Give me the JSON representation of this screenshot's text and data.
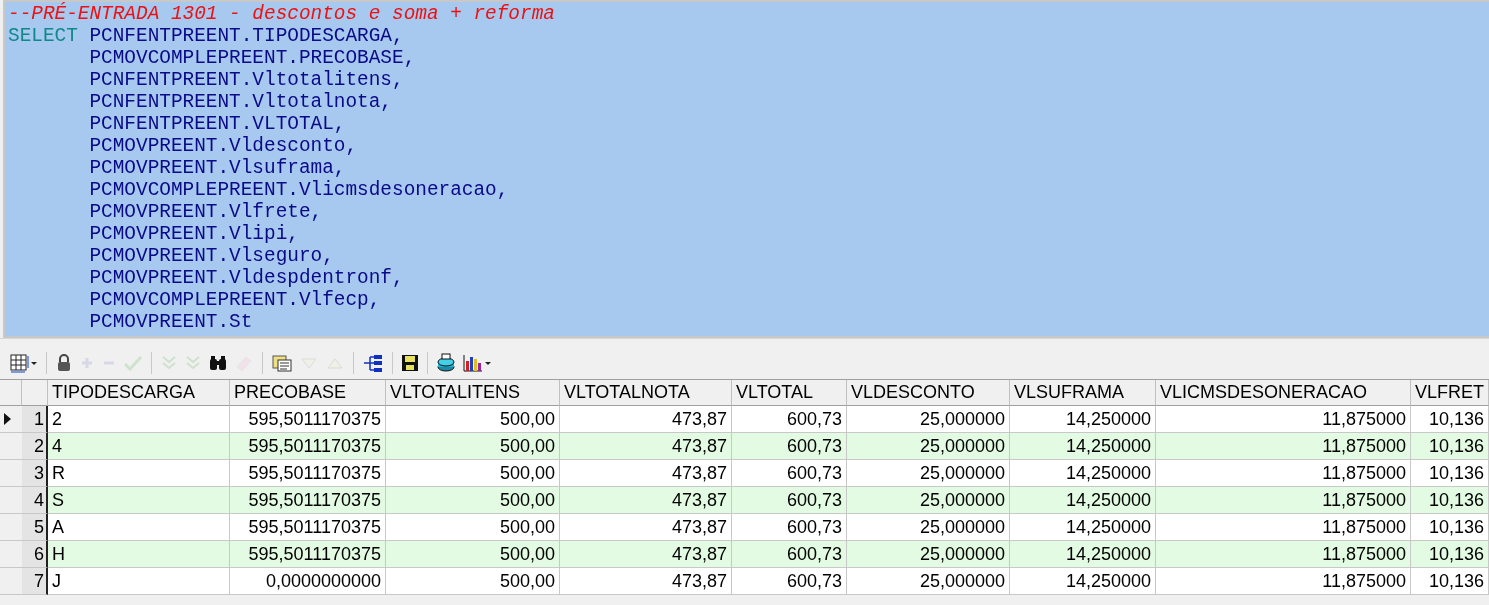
{
  "editor": {
    "lines": [
      {
        "kind": "comment",
        "code": "--PRÉ-ENTRADA 1301 - descontos e soma + reforma"
      },
      {
        "kind": "code",
        "keyword": "SELECT",
        "code": "PCNFENTPREENT.TIPODESCARGA,"
      },
      {
        "kind": "code",
        "code": "PCMOVCOMPLEPREENT.PRECOBASE,"
      },
      {
        "kind": "code",
        "code": "PCNFENTPREENT.Vltotalitens,"
      },
      {
        "kind": "code",
        "code": "PCNFENTPREENT.Vltotalnota,"
      },
      {
        "kind": "code",
        "code": "PCNFENTPREENT.VLTOTAL,"
      },
      {
        "kind": "code",
        "code": "PCMOVPREENT.Vldesconto,"
      },
      {
        "kind": "code",
        "code": "PCMOVPREENT.Vlsuframa,"
      },
      {
        "kind": "code",
        "code": "PCMOVCOMPLEPREENT.Vlicmsdesoneracao,"
      },
      {
        "kind": "code",
        "code": "PCMOVPREENT.Vlfrete,"
      },
      {
        "kind": "code",
        "code": "PCMOVPREENT.Vlipi,"
      },
      {
        "kind": "code",
        "code": "PCMOVPREENT.Vlseguro,"
      },
      {
        "kind": "code",
        "code": "PCMOVPREENT.Vldespdentronf,"
      },
      {
        "kind": "code",
        "code": "PCMOVCOMPLEPREENT.Vlfecp,"
      },
      {
        "kind": "code",
        "code": "PCMOVPREENT.St"
      }
    ]
  },
  "toolbar": [
    {
      "kind": "grid",
      "disabled": false
    },
    {
      "kind": "separator"
    },
    {
      "kind": "lock",
      "disabled": false
    },
    {
      "kind": "plus",
      "disabled": true
    },
    {
      "kind": "minus",
      "disabled": true
    },
    {
      "kind": "check",
      "disabled": true
    },
    {
      "kind": "separator"
    },
    {
      "kind": "chevrons",
      "disabled": true
    },
    {
      "kind": "chevrons",
      "disabled": true
    },
    {
      "kind": "binoculars",
      "disabled": false
    },
    {
      "kind": "eraser",
      "disabled": true
    },
    {
      "kind": "separator"
    },
    {
      "kind": "notes",
      "disabled": false
    },
    {
      "kind": "down",
      "disabled": true
    },
    {
      "kind": "up",
      "disabled": true
    },
    {
      "kind": "separator"
    },
    {
      "kind": "tree",
      "disabled": false
    },
    {
      "kind": "separator"
    },
    {
      "kind": "save",
      "disabled": false
    },
    {
      "kind": "separator"
    },
    {
      "kind": "database",
      "disabled": false
    },
    {
      "kind": "chart",
      "disabled": false
    }
  ],
  "table": {
    "columns": [
      {
        "label": "TIPODESCARGA"
      },
      {
        "label": "PRECOBASE"
      },
      {
        "label": "VLTOTALITENS"
      },
      {
        "label": "VLTOTALNOTA"
      },
      {
        "label": "VLTOTAL"
      },
      {
        "label": "VLDESCONTO"
      },
      {
        "label": "VLSUFRAMA"
      },
      {
        "label": "VLICMSDESONERACAO"
      },
      {
        "label": "VLFRET"
      }
    ],
    "rows": [
      {
        "number": "1",
        "selected": true,
        "cells": [
          "2",
          "595,5011170375",
          "500,00",
          "473,87",
          "600,73",
          "25,000000",
          "14,250000",
          "11,875000",
          "10,136"
        ]
      },
      {
        "number": "2",
        "selected": false,
        "cells": [
          "4",
          "595,5011170375",
          "500,00",
          "473,87",
          "600,73",
          "25,000000",
          "14,250000",
          "11,875000",
          "10,136"
        ]
      },
      {
        "number": "3",
        "selected": false,
        "cells": [
          "R",
          "595,5011170375",
          "500,00",
          "473,87",
          "600,73",
          "25,000000",
          "14,250000",
          "11,875000",
          "10,136"
        ]
      },
      {
        "number": "4",
        "selected": false,
        "cells": [
          "S",
          "595,5011170375",
          "500,00",
          "473,87",
          "600,73",
          "25,000000",
          "14,250000",
          "11,875000",
          "10,136"
        ]
      },
      {
        "number": "5",
        "selected": false,
        "cells": [
          "A",
          "595,5011170375",
          "500,00",
          "473,87",
          "600,73",
          "25,000000",
          "14,250000",
          "11,875000",
          "10,136"
        ]
      },
      {
        "number": "6",
        "selected": false,
        "cells": [
          "H",
          "595,5011170375",
          "500,00",
          "473,87",
          "600,73",
          "25,000000",
          "14,250000",
          "11,875000",
          "10,136"
        ]
      },
      {
        "number": "7",
        "selected": false,
        "cells": [
          "J",
          "0,0000000000",
          "500,00",
          "473,87",
          "600,73",
          "25,000000",
          "14,250000",
          "11,875000",
          "10,136"
        ]
      }
    ]
  }
}
